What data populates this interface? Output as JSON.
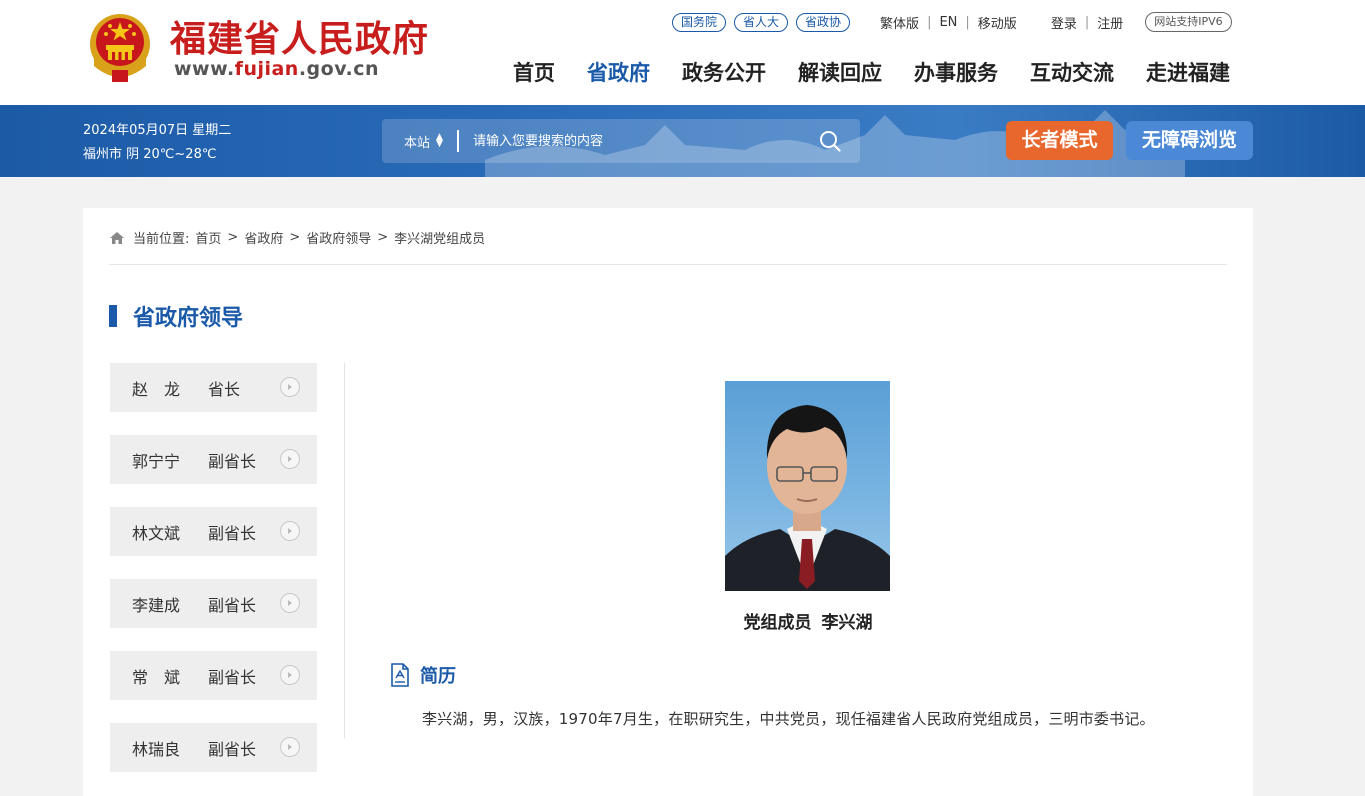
{
  "site": {
    "name_cn": "福建省人民政府",
    "url_prefix": "www.",
    "url_domain": "fujian",
    "url_suffix": ".gov.cn"
  },
  "toplinks": {
    "pills": [
      "国务院",
      "省人大",
      "省政协"
    ],
    "lang": [
      "繁体版",
      "EN",
      "移动版"
    ],
    "auth": [
      "登录",
      "注册"
    ],
    "ipv6": "网站支持IPV6"
  },
  "nav": {
    "items": [
      "首页",
      "省政府",
      "政务公开",
      "解读回应",
      "办事服务",
      "互动交流",
      "走进福建"
    ],
    "active_index": 1
  },
  "band": {
    "date": "2024年05月07日 星期二",
    "weather": "福州市 阴 20℃~28℃",
    "search_scope": "本站",
    "search_placeholder": "请输入您要搜索的内容",
    "elder_mode": "长者模式",
    "accessible": "无障碍浏览"
  },
  "breadcrumb": {
    "prefix": "当前位置:",
    "items": [
      "首页",
      "省政府",
      "省政府领导",
      "李兴湖党组成员"
    ]
  },
  "section_title": "省政府领导",
  "leaders": [
    {
      "name": "赵　龙",
      "title": "省长"
    },
    {
      "name": "郭宁宁",
      "title": "副省长"
    },
    {
      "name": "林文斌",
      "title": "副省长"
    },
    {
      "name": "李建成",
      "title": "副省长"
    },
    {
      "name": "常　斌",
      "title": "副省长"
    },
    {
      "name": "林瑞良",
      "title": "副省长"
    }
  ],
  "profile": {
    "position": "党组成员",
    "name": "李兴湖",
    "resume_label": "简历",
    "bio": "李兴湖，男，汉族，1970年7月生，在职研究生，中共党员，现任福建省人民政府党组成员，三明市委书记。"
  },
  "colors": {
    "brand_red": "#c81d1d",
    "brand_blue": "#1a5aa8",
    "elder_orange": "#e8672d",
    "access_blue": "#4b88d6"
  }
}
